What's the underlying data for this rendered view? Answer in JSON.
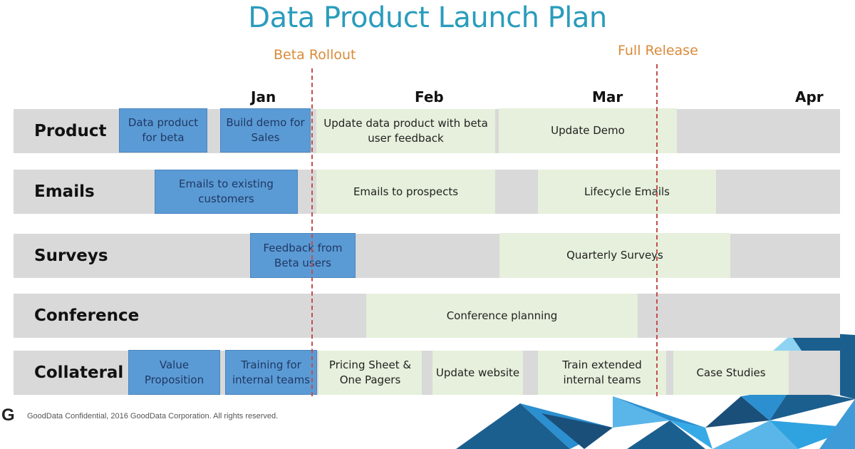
{
  "title": "Data Product Launch Plan",
  "milestones": [
    {
      "label": "Beta Rollout",
      "color": "#d98b3a"
    },
    {
      "label": "Full Release",
      "color": "#d98b3a"
    }
  ],
  "months": [
    "Jan",
    "Feb",
    "Mar",
    "Apr"
  ],
  "lanes": [
    {
      "label": "Product",
      "tasks": [
        {
          "label": "Data product for beta",
          "type": "blue"
        },
        {
          "label": "Build demo for Sales",
          "type": "blue"
        },
        {
          "label": "Update data product with beta user feedback",
          "type": "green"
        },
        {
          "label": "Update Demo",
          "type": "green"
        }
      ]
    },
    {
      "label": "Emails",
      "tasks": [
        {
          "label": "Emails to existing customers",
          "type": "blue"
        },
        {
          "label": "Emails to prospects",
          "type": "green"
        },
        {
          "label": "Lifecycle Emails",
          "type": "green"
        }
      ]
    },
    {
      "label": "Surveys",
      "tasks": [
        {
          "label": "Feedback from Beta users",
          "type": "blue"
        },
        {
          "label": "Quarterly Surveys",
          "type": "green"
        }
      ]
    },
    {
      "label": "Conference",
      "tasks": [
        {
          "label": "Conference planning",
          "type": "green"
        }
      ]
    },
    {
      "label": "Collateral",
      "tasks": [
        {
          "label": "Value Proposition",
          "type": "blue"
        },
        {
          "label": "Training for internal teams",
          "type": "blue"
        },
        {
          "label": "Pricing Sheet & One Pagers",
          "type": "green"
        },
        {
          "label": "Update website",
          "type": "green"
        },
        {
          "label": "Train extended internal teams",
          "type": "green"
        },
        {
          "label": "Case Studies",
          "type": "green"
        }
      ]
    }
  ],
  "colors": {
    "blue_task": "#5b9bd5",
    "green_task": "#e6f0dc",
    "lane": "#d9d9d9",
    "title": "#2a9cbc",
    "milestone_line": "#c0504d"
  },
  "footer": {
    "logo": "G",
    "text": "GoodData Confidential, 2016 GoodData Corporation. All rights reserved."
  }
}
